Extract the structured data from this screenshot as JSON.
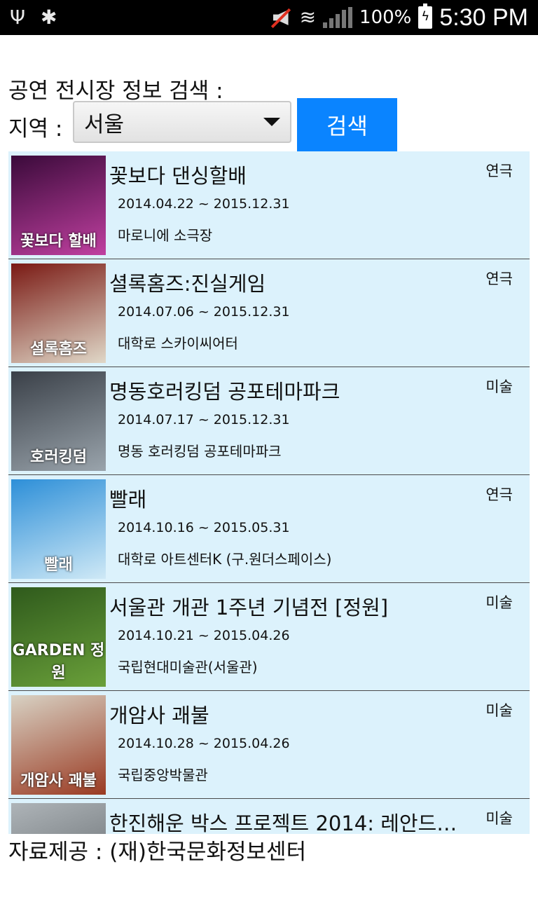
{
  "status_bar": {
    "icons": [
      "usb-icon",
      "bug-icon",
      "mute-icon",
      "wifi-lock-icon",
      "signal-icon",
      "battery-charging-icon"
    ],
    "battery_percent": "100%",
    "time": "5:30 PM"
  },
  "search": {
    "title": "공연 전시장 정보 검색 :",
    "region_label": "지역 :",
    "region_value": "서울",
    "button_label": "검색"
  },
  "items": [
    {
      "name": "꽃보다 댄싱할배",
      "date": "2014.04.22 ~ 2015.12.31",
      "venue": "마로니에 소극장",
      "category": "연극",
      "thumb_text": "꽃보다 할배",
      "thumb_colors": [
        "#3a0a3a",
        "#c040a0"
      ]
    },
    {
      "name": "셜록홈즈:진실게임",
      "date": "2014.07.06 ~ 2015.12.31",
      "venue": "대학로 스카이씨어터",
      "category": "연극",
      "thumb_text": "셜록홈즈",
      "thumb_colors": [
        "#7a1a14",
        "#e0d8c8"
      ]
    },
    {
      "name": "명동호러킹덤 공포테마파크",
      "date": "2014.07.17 ~ 2015.12.31",
      "venue": "명동 호러킹덤 공포테마파크",
      "category": "미술",
      "thumb_text": "호러킹덤",
      "thumb_colors": [
        "#3a4048",
        "#9aa4ac"
      ]
    },
    {
      "name": "빨래",
      "date": "2014.10.16 ~ 2015.05.31",
      "venue": "대학로 아트센터K (구.원더스페이스)",
      "category": "연극",
      "thumb_text": "빨래",
      "thumb_colors": [
        "#2d8fd8",
        "#cfe9f6"
      ]
    },
    {
      "name": "서울관 개관 1주년 기념전 [정원]",
      "date": "2014.10.21 ~ 2015.04.26",
      "venue": "국립현대미술관(서울관)",
      "category": "미술",
      "thumb_text": "GARDEN 정원",
      "thumb_colors": [
        "#2f5a1c",
        "#6aa03a"
      ]
    },
    {
      "name": "개암사 괘불",
      "date": "2014.10.28 ~ 2015.04.26",
      "venue": "국립중앙박물관",
      "category": "미술",
      "thumb_text": "개암사 괘불",
      "thumb_colors": [
        "#d8d2c4",
        "#9a3a22"
      ]
    },
    {
      "name": "한진해운 박스 프로젝트 2014: 레안드로 …",
      "date": "",
      "venue": "",
      "category": "미술",
      "thumb_text": "",
      "thumb_colors": [
        "#aeb4b8",
        "#5c6266"
      ]
    }
  ],
  "footer": {
    "credit": "자료제공 : (재)한국문화정보센터"
  }
}
